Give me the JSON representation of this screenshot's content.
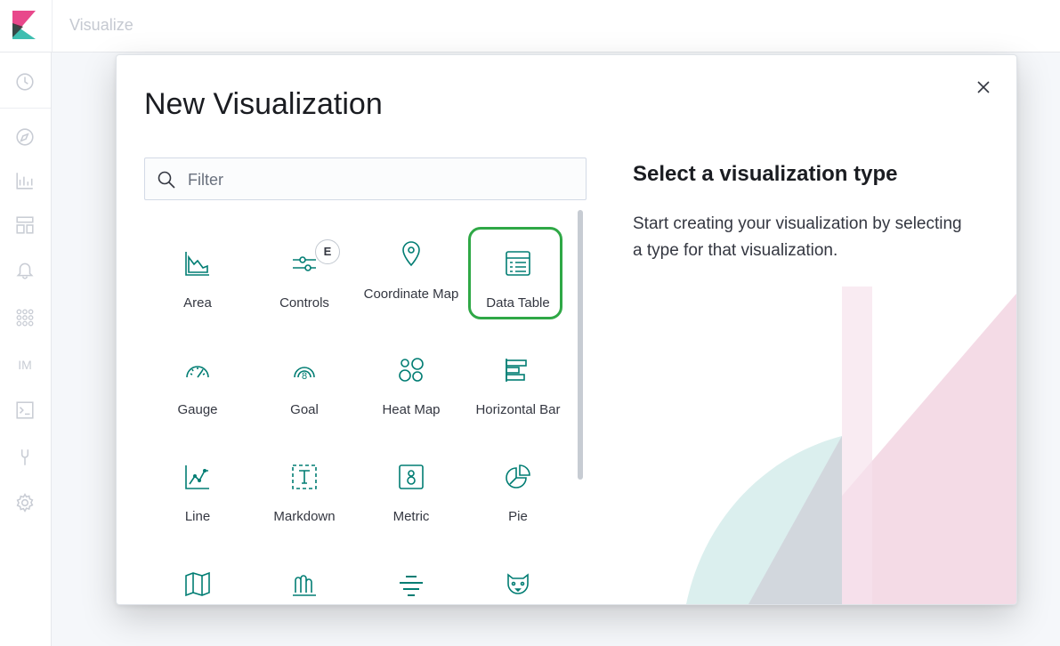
{
  "header": {
    "app_title": "Visualize"
  },
  "sidenav": {
    "items": [
      {
        "icon": "clock-icon"
      },
      {
        "icon": "compass-icon"
      },
      {
        "icon": "visualize-icon"
      },
      {
        "icon": "dashboard-icon"
      },
      {
        "icon": "bell-icon"
      },
      {
        "icon": "apps-grid-icon"
      },
      {
        "icon": "im-text",
        "label": "IM"
      },
      {
        "icon": "console-icon"
      },
      {
        "icon": "wrench-icon"
      },
      {
        "icon": "gear-icon"
      }
    ]
  },
  "modal": {
    "title": "New Visualization",
    "filter_placeholder": "Filter",
    "description_title": "Select a visualization type",
    "description_text": "Start creating your visualization by selecting a type for that visualization.",
    "types": [
      {
        "label": "Area",
        "icon": "area-chart-icon"
      },
      {
        "label": "Controls",
        "icon": "controls-icon",
        "badge": "E"
      },
      {
        "label": "Coordinate Map",
        "icon": "map-pin-icon"
      },
      {
        "label": "Data Table",
        "icon": "table-icon",
        "selected": true
      },
      {
        "label": "Gauge",
        "icon": "gauge-icon"
      },
      {
        "label": "Goal",
        "icon": "goal-icon"
      },
      {
        "label": "Heat Map",
        "icon": "heatmap-icon"
      },
      {
        "label": "Horizontal Bar",
        "icon": "horizontal-bar-icon"
      },
      {
        "label": "Line",
        "icon": "line-chart-icon"
      },
      {
        "label": "Markdown",
        "icon": "markdown-icon"
      },
      {
        "label": "Metric",
        "icon": "metric-icon"
      },
      {
        "label": "Pie",
        "icon": "pie-chart-icon"
      },
      {
        "label": "",
        "icon": "region-map-icon"
      },
      {
        "label": "",
        "icon": "tsvb-icon"
      },
      {
        "label": "",
        "icon": "tag-cloud-icon"
      },
      {
        "label": "",
        "icon": "vega-icon"
      }
    ]
  },
  "colors": {
    "accent": "#017d73",
    "selection": "#2fa846",
    "text": "#343741"
  }
}
